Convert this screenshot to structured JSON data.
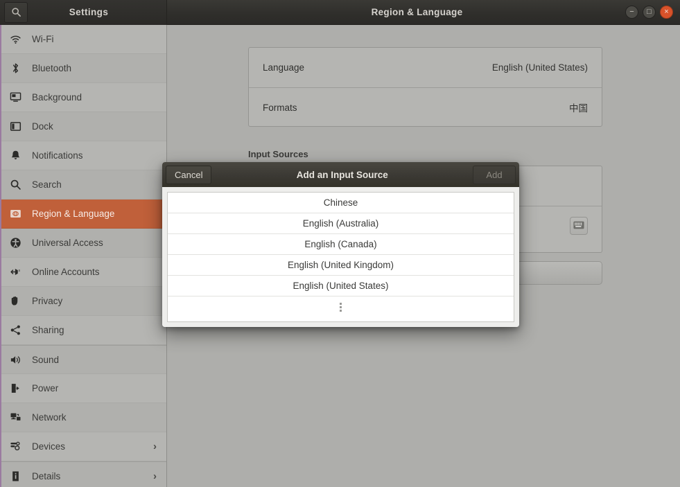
{
  "titlebar": {
    "settings_label": "Settings",
    "window_title": "Region & Language",
    "search_icon": "search-icon",
    "minimize": "−",
    "maximize": "□",
    "close": "×"
  },
  "sidebar": {
    "items": [
      {
        "label": "Wi-Fi",
        "icon": "wifi-icon",
        "chevron": "",
        "selected": false
      },
      {
        "label": "Bluetooth",
        "icon": "bluetooth-icon",
        "chevron": "",
        "selected": false
      },
      {
        "label": "Background",
        "icon": "background-icon",
        "chevron": "",
        "selected": false
      },
      {
        "label": "Dock",
        "icon": "dock-icon",
        "chevron": "",
        "selected": false
      },
      {
        "label": "Notifications",
        "icon": "bell-icon",
        "chevron": "",
        "selected": false
      },
      {
        "label": "Search",
        "icon": "search-icon",
        "chevron": "",
        "selected": false
      },
      {
        "label": "Region & Language",
        "icon": "region-language-icon",
        "chevron": "",
        "selected": true
      },
      {
        "label": "Universal Access",
        "icon": "accessibility-icon",
        "chevron": "",
        "selected": false
      },
      {
        "label": "Online Accounts",
        "icon": "online-accounts-icon",
        "chevron": "",
        "selected": false
      },
      {
        "label": "Privacy",
        "icon": "hand-icon",
        "chevron": "",
        "selected": false
      },
      {
        "label": "Sharing",
        "icon": "share-icon",
        "chevron": "",
        "selected": false
      },
      {
        "label": "Sound",
        "icon": "speaker-icon",
        "chevron": "",
        "selected": false
      },
      {
        "label": "Power",
        "icon": "power-icon",
        "chevron": "",
        "selected": false
      },
      {
        "label": "Network",
        "icon": "network-icon",
        "chevron": "",
        "selected": false
      },
      {
        "label": "Devices",
        "icon": "devices-icon",
        "chevron": "›",
        "selected": false
      },
      {
        "label": "Details",
        "icon": "info-icon",
        "chevron": "›",
        "selected": false
      }
    ]
  },
  "main": {
    "language_row": {
      "key": "Language",
      "value": "English (United States)"
    },
    "formats_row": {
      "key": "Formats",
      "value": "中国"
    },
    "input_sources_title": "Input Sources",
    "keyboard_icon": "keyboard-icon"
  },
  "modal": {
    "cancel_label": "Cancel",
    "title": "Add an Input Source",
    "add_label": "Add",
    "options": [
      "Chinese",
      "English (Australia)",
      "English (Canada)",
      "English (United Kingdom)",
      "English (United States)"
    ],
    "more_indicator": "more-options-dots"
  },
  "colors": {
    "accent": "#c0603a",
    "sidebar_bg": "#b5b5b2",
    "content_bg": "#aeaeab",
    "titlebar_bg": "#2f2e2b",
    "close_button": "#d8522a",
    "left_edge_accent": "#9a7ba0"
  }
}
